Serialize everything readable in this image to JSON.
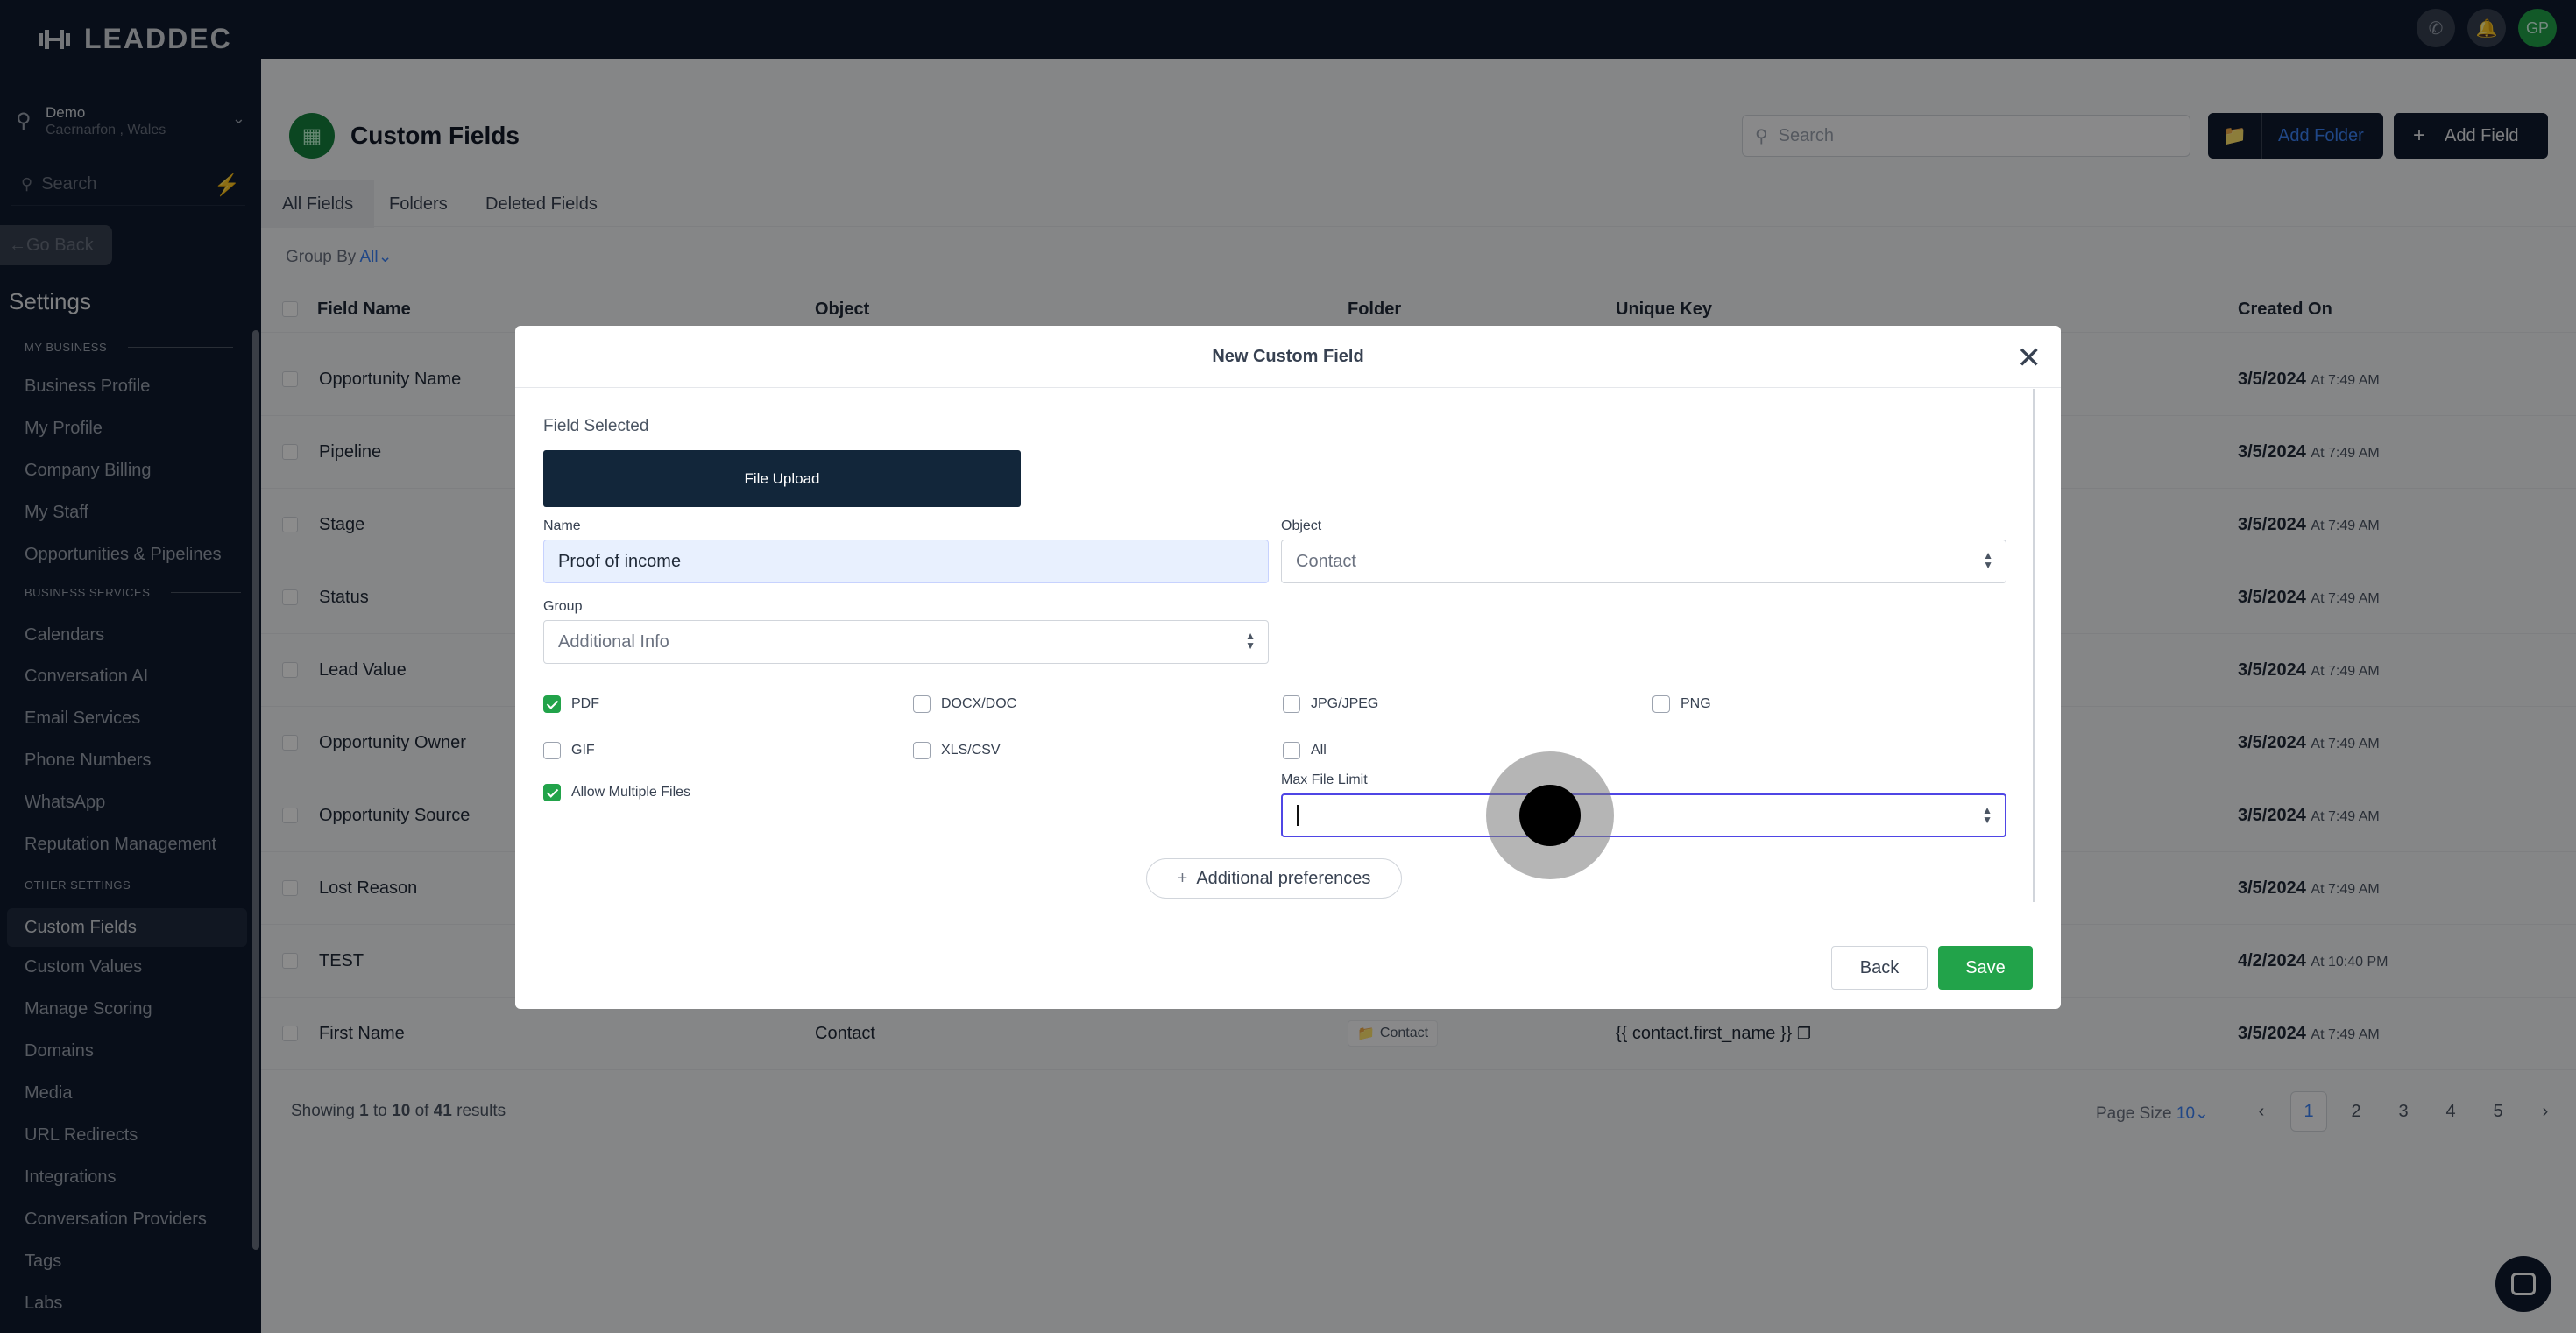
{
  "brand": {
    "name": "LEADDEC"
  },
  "topbar": {
    "avatar_initials": "GP"
  },
  "sidebar": {
    "location_name": "Demo",
    "location_city": "Caernarfon , Wales",
    "search_placeholder": "Search",
    "go_back": "Go Back",
    "settings_title": "Settings",
    "sections": [
      {
        "label": "MY BUSINESS",
        "items": [
          "Business Profile",
          "My Profile",
          "Company Billing",
          "My Staff",
          "Opportunities & Pipelines"
        ]
      },
      {
        "label": "BUSINESS SERVICES",
        "items": [
          "Calendars",
          "Conversation AI",
          "Email Services",
          "Phone Numbers",
          "WhatsApp",
          "Reputation Management"
        ]
      },
      {
        "label": "OTHER SETTINGS",
        "items": [
          "Custom Fields",
          "Custom Values",
          "Manage Scoring",
          "Domains",
          "Media",
          "URL Redirects",
          "Integrations",
          "Conversation Providers",
          "Tags",
          "Labs"
        ]
      }
    ],
    "active_item": "Custom Fields"
  },
  "page": {
    "title": "Custom Fields",
    "search_placeholder": "Search",
    "add_folder": "Add Folder",
    "add_field": "Add Field",
    "tabs": [
      "All Fields",
      "Folders",
      "Deleted Fields"
    ],
    "group_by_label": "Group By",
    "group_by_value": "All"
  },
  "table": {
    "headers": [
      "Field Name",
      "Object",
      "Folder",
      "Unique Key",
      "Created On"
    ],
    "rows": [
      {
        "name": "Opportunity Name",
        "date": "3/5/2024",
        "time": "At 7:49 AM"
      },
      {
        "name": "Pipeline",
        "date": "3/5/2024",
        "time": "At 7:49 AM"
      },
      {
        "name": "Stage",
        "date": "3/5/2024",
        "time": "At 7:49 AM"
      },
      {
        "name": "Status",
        "date": "3/5/2024",
        "time": "At 7:49 AM"
      },
      {
        "name": "Lead Value",
        "date": "3/5/2024",
        "time": "At 7:49 AM"
      },
      {
        "name": "Opportunity Owner",
        "date": "3/5/2024",
        "time": "At 7:49 AM"
      },
      {
        "name": "Opportunity Source",
        "date": "3/5/2024",
        "time": "At 7:49 AM"
      },
      {
        "name": "Lost Reason",
        "date": "3/5/2024",
        "time": "At 7:49 AM"
      },
      {
        "name": "TEST",
        "date": "4/2/2024",
        "time": "At 10:40 PM"
      },
      {
        "name": "First Name",
        "object": "Contact",
        "folder": "Contact",
        "unique_key": "{{ contact.first_name }}",
        "date": "3/5/2024",
        "time": "At 7:49 AM"
      }
    ],
    "showing": {
      "prefix": "Showing",
      "from": "1",
      "to_word": "to",
      "to": "10",
      "of_word": "of",
      "total": "41",
      "suffix": "results"
    },
    "page_size_label": "Page Size",
    "page_size_value": "10",
    "pages": [
      "1",
      "2",
      "3",
      "4",
      "5"
    ],
    "current_page": "1"
  },
  "modal": {
    "title": "New Custom Field",
    "field_selected_label": "Field Selected",
    "field_type": "File Upload",
    "name_label": "Name",
    "name_value": "Proof of income",
    "object_label": "Object",
    "object_value": "Contact",
    "group_label": "Group",
    "group_value": "Additional Info",
    "file_types": [
      {
        "label": "PDF",
        "checked": true
      },
      {
        "label": "DOCX/DOC",
        "checked": false
      },
      {
        "label": "JPG/JPEG",
        "checked": false
      },
      {
        "label": "PNG",
        "checked": false
      },
      {
        "label": "GIF",
        "checked": false
      },
      {
        "label": "XLS/CSV",
        "checked": false
      },
      {
        "label": "All",
        "checked": false
      }
    ],
    "allow_multiple_label": "Allow Multiple Files",
    "allow_multiple_checked": true,
    "max_file_limit_label": "Max File Limit",
    "max_file_limit_value": "",
    "additional_preferences": "Additional preferences",
    "back": "Back",
    "save": "Save"
  },
  "colors": {
    "accent_green": "#22a34a",
    "dark_navy": "#0f1a2e",
    "link_blue": "#3b82f6"
  }
}
